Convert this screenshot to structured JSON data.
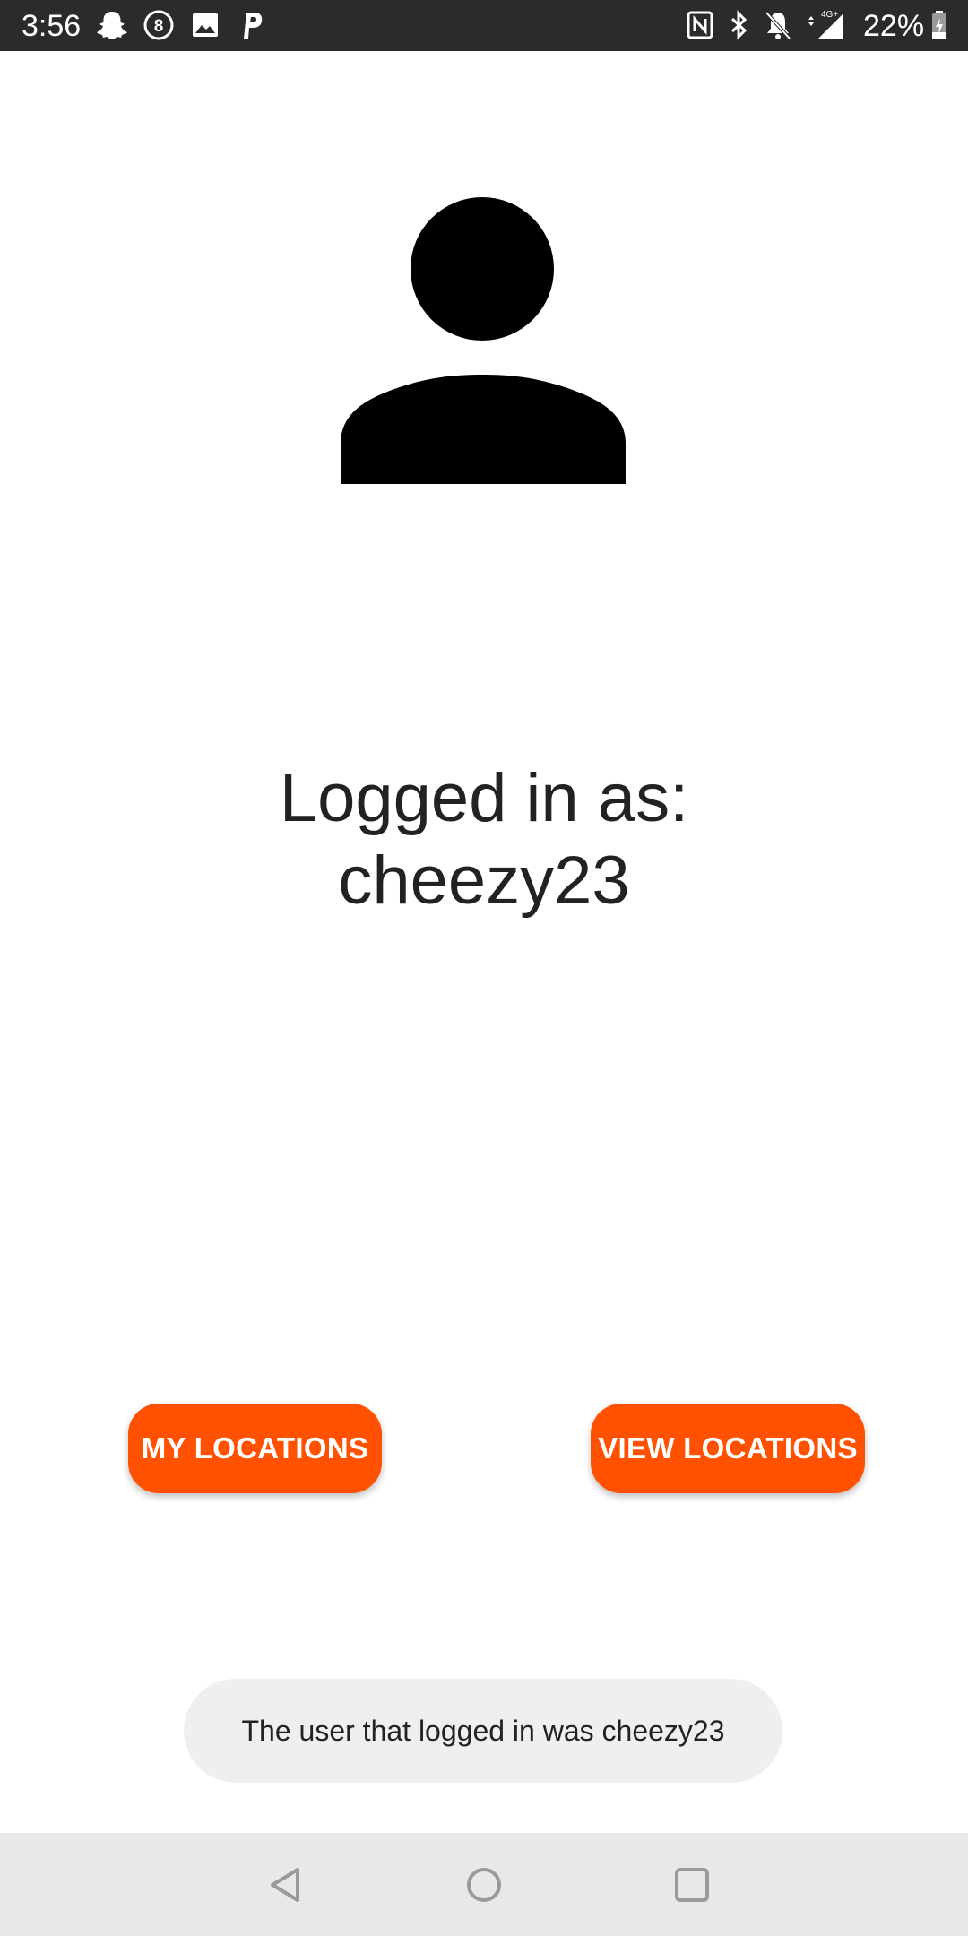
{
  "status_bar": {
    "time": "3:56",
    "battery_percent": "22%",
    "network": "4G+",
    "left_icons": [
      "snapchat-icon",
      "notification-8-icon",
      "image-icon",
      "p-app-icon"
    ],
    "right_icons": [
      "nfc-icon",
      "bluetooth-icon",
      "bell-off-icon",
      "signal-icon",
      "battery-icon"
    ]
  },
  "profile": {
    "avatar_icon": "person-icon",
    "logged_in_label": "Logged in as:",
    "username": "cheezy23"
  },
  "buttons": {
    "my_locations": "MY LOCATIONS",
    "view_locations": "VIEW LOCATIONS"
  },
  "toast": {
    "message": "The user that logged in was cheezy23"
  },
  "nav_bar": {
    "icons": [
      "back-icon",
      "home-icon",
      "recents-icon"
    ]
  },
  "colors": {
    "accent": "#FF5100",
    "status_bar_bg": "#2B2B2B",
    "nav_bar_bg": "#E8E8E8",
    "toast_bg": "#EFEFEF",
    "text": "#222222"
  }
}
